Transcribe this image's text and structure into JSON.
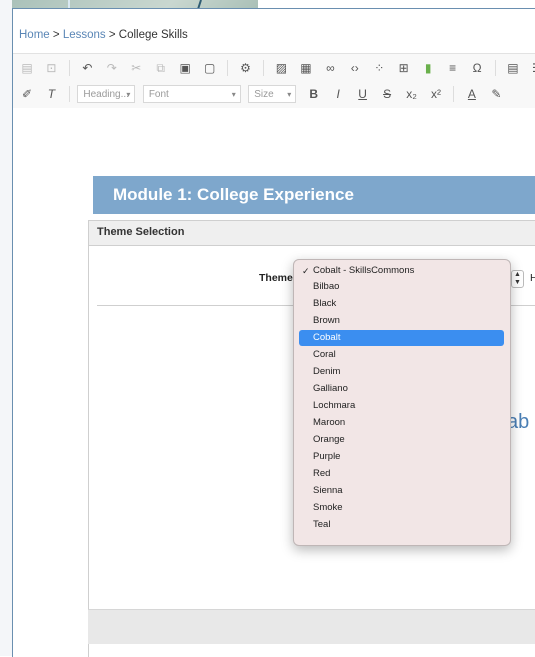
{
  "breadcrumb": {
    "home": "Home",
    "sep1": ">",
    "lessons": "Lessons",
    "sep2": ">",
    "current": "College Skills"
  },
  "toolbar": {
    "row1_icons": [
      "save-icon",
      "preview-icon",
      "undo-icon",
      "redo-icon",
      "cut-icon",
      "copy-icon",
      "paste-icon",
      "paste-text-icon",
      "settings-icon",
      "image-icon",
      "media-icon",
      "link-icon",
      "code-icon",
      "template-icon",
      "table-icon",
      "widget-icon",
      "horizontal-line-icon",
      "special-char-icon",
      "iframe-icon",
      "list-icon"
    ],
    "row2_icons": [
      "format-painter-icon",
      "clear-formatting-icon"
    ],
    "heading": "Heading...",
    "font": "Font",
    "size": "Size",
    "bold": "B",
    "italic": "I",
    "underline": "U",
    "strike": "S",
    "subscript": "x₂",
    "superscript": "x²",
    "text_color": "A",
    "highlight": "✎"
  },
  "module": {
    "title": "Module 1: College Experience"
  },
  "panel": {
    "title": "Theme Selection",
    "theme_label": "Theme:",
    "after_label": "H",
    "preview_text": "ab"
  },
  "dropdown": {
    "items": [
      "Cobalt - SkillsCommons",
      "Bilbao",
      "Black",
      "Brown",
      "Cobalt",
      "Coral",
      "Denim",
      "Galliano",
      "Lochmara",
      "Maroon",
      "Orange",
      "Purple",
      "Red",
      "Sienna",
      "Smoke",
      "Teal"
    ],
    "checked": "Cobalt - SkillsCommons",
    "highlighted": "Cobalt",
    "check_mark": "✓"
  },
  "colors": {
    "module_bar": "#7ea7cc",
    "link": "#5a86b6",
    "highlight": "#3b8ef0",
    "dropdown_bg": "#f2e6e6"
  }
}
